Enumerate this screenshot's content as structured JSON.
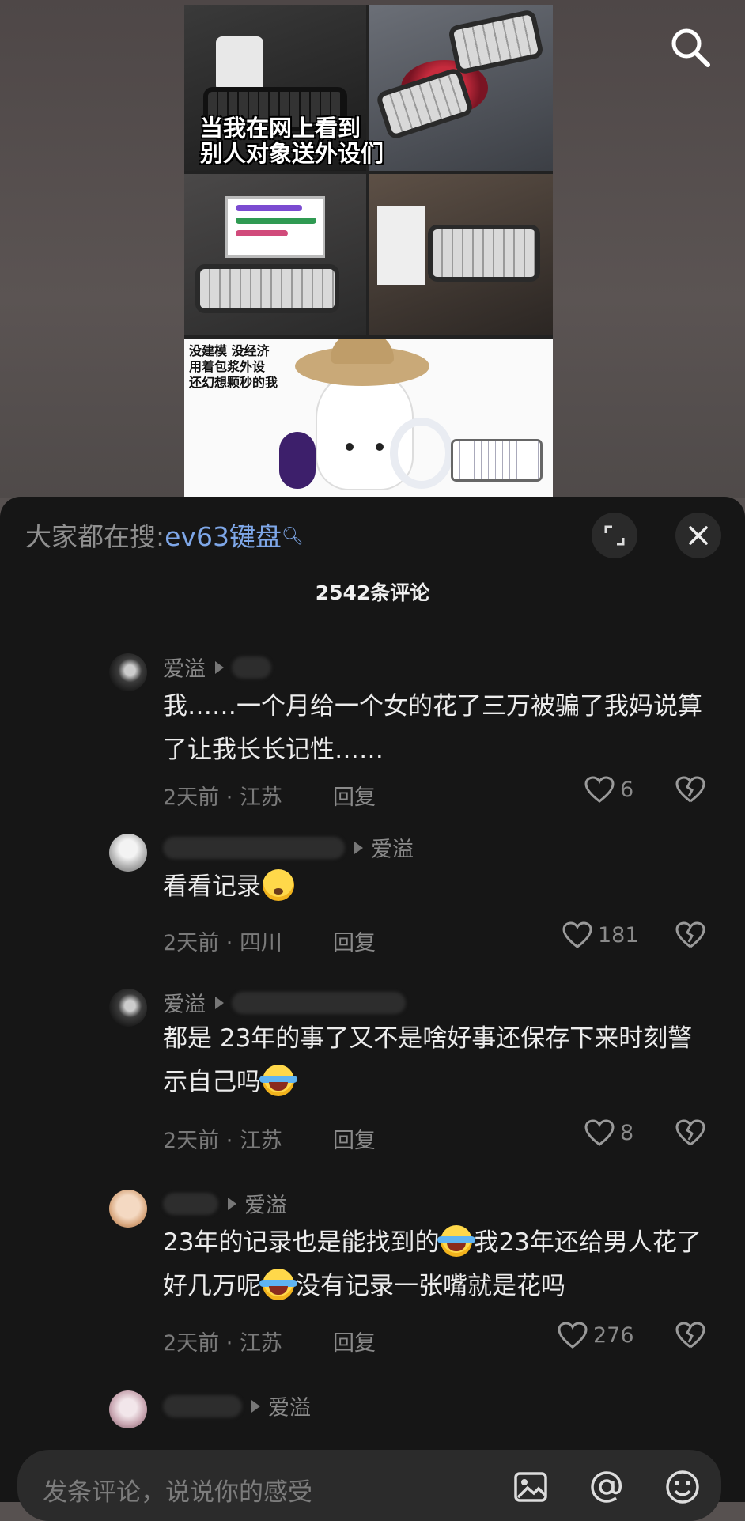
{
  "video": {
    "overlay_text": "当我在网上看到\n别人对象送外设们",
    "meme_text": "没建模 没经济\n用着包浆外设\n还幻想颗秒的我"
  },
  "sheet": {
    "trending_prefix": "大家都在搜:",
    "trending_keyword": "ev63键盘",
    "comment_count": "2542条评论"
  },
  "comments": [
    {
      "author": "爱溢",
      "text": "我……一个月给一个女的花了三万被骗了我妈说算了让我长长记性……",
      "time": "2天前",
      "location": "江苏",
      "reply_label": "回复",
      "likes": "6"
    },
    {
      "reply_to": "爱溢",
      "text": "看看记录",
      "time": "2天前",
      "location": "四川",
      "reply_label": "回复",
      "likes": "181"
    },
    {
      "author": "爱溢",
      "text": "都是 23年的事了又不是啥好事还保存下来时刻警示自己吗",
      "time": "2天前",
      "location": "江苏",
      "reply_label": "回复",
      "likes": "8"
    },
    {
      "reply_to": "爱溢",
      "text_a": "23年的记录也是能找到的",
      "text_b": "我23年还给男人花了好几万呢",
      "text_c": "没有记录一张嘴就是花吗",
      "time": "2天前",
      "location": "江苏",
      "reply_label": "回复",
      "likes": "276"
    },
    {
      "reply_to": "爱溢"
    }
  ],
  "input": {
    "placeholder": "发条评论，说说你的感受"
  },
  "colors": {
    "sheet_bg": "#161616",
    "keyword_blue": "#7ea7e8",
    "muted_text": "#8a8a8a"
  }
}
